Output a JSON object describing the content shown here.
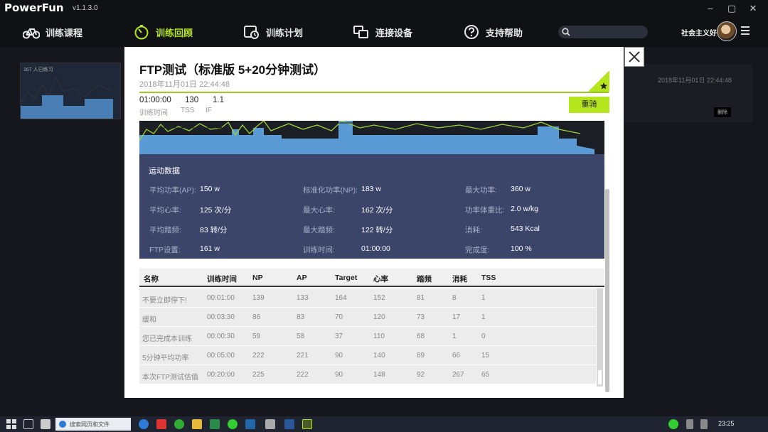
{
  "app": {
    "name": "PowerFun",
    "version": "v1.1.3.0"
  },
  "nav": {
    "items": [
      {
        "label": "训练课程",
        "icon": "bike-icon"
      },
      {
        "label": "训练回顾",
        "icon": "timer-icon",
        "active": true
      },
      {
        "label": "训练计划",
        "icon": "calendar-clock-icon"
      },
      {
        "label": "连接设备",
        "icon": "devices-icon"
      },
      {
        "label": "支持帮助",
        "icon": "help-icon"
      }
    ],
    "username": "社会主义好"
  },
  "background": {
    "thumb_label": "167 人已练习",
    "date": "2018年11月01日 22:44:48",
    "delete_label": "删除"
  },
  "modal": {
    "title": "FTP测试（标准版 5+20分钟测试）",
    "date": "2018年11月01日 22:44:48",
    "stats": [
      {
        "value": "01:00:00",
        "label": "训练时间"
      },
      {
        "value": "130",
        "label": "TSS"
      },
      {
        "value": "1.1",
        "label": "IF"
      }
    ],
    "ride_button": "重骑",
    "metrics_title": "运动数据",
    "metrics": [
      {
        "label": "平均功率(AP):",
        "value": "150 w"
      },
      {
        "label": "标准化功率(NP):",
        "value": "183 w"
      },
      {
        "label": "最大功率:",
        "value": "360 w"
      },
      {
        "label": "平均心率:",
        "value": "125 次/分"
      },
      {
        "label": "最大心率:",
        "value": "162 次/分"
      },
      {
        "label": "功率体重比:",
        "value": "2.0 w/kg"
      },
      {
        "label": "平均踏频:",
        "value": "83 转/分"
      },
      {
        "label": "最大踏频:",
        "value": "122 转/分"
      },
      {
        "label": "消耗:",
        "value": "543 Kcal"
      },
      {
        "label": "FTP设置:",
        "value": "161 w"
      },
      {
        "label": "训练时间:",
        "value": "01:00:00"
      },
      {
        "label": "完成度:",
        "value": "100 %"
      }
    ],
    "table": {
      "headers": [
        "名称",
        "训练时间",
        "NP",
        "AP",
        "Target",
        "心率",
        "踏频",
        "消耗",
        "TSS"
      ],
      "rows": [
        [
          "不要立即停下!",
          "00:01:00",
          "139",
          "133",
          "164",
          "152",
          "81",
          "8",
          "1"
        ],
        [
          "缓和",
          "00:03:30",
          "86",
          "83",
          "70",
          "120",
          "73",
          "17",
          "1"
        ],
        [
          "您已完成本训练",
          "00:00:30",
          "59",
          "58",
          "37",
          "110",
          "68",
          "1",
          "0"
        ],
        [
          "5分钟平均功率",
          "00:05:00",
          "222",
          "221",
          "90",
          "140",
          "89",
          "66",
          "15"
        ],
        [
          "本次FTP测试估值",
          "00:20:00",
          "225",
          "222",
          "90",
          "148",
          "92",
          "267",
          "65"
        ]
      ]
    }
  },
  "taskbar": {
    "search_placeholder": "搜索网页和文件",
    "time": "23:25"
  },
  "colors": {
    "accent": "#b5e61d",
    "panel": "#3b4569",
    "chart_fill": "#5b9bd5"
  }
}
